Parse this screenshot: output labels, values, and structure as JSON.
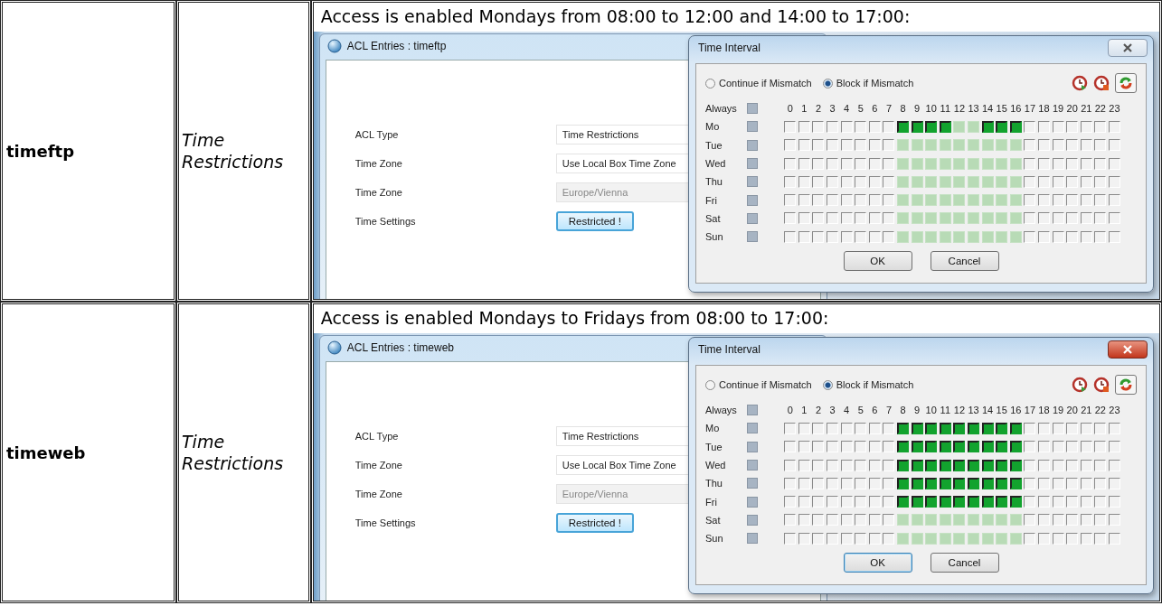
{
  "table": {
    "rows": [
      {
        "name": "timeftp",
        "type": "Time Restrictions",
        "caption": "Access is enabled Mondays from 08:00 to 12:00 and 14:00 to 17:00:",
        "window": {
          "title": "ACL Entries : timeftp",
          "fields": [
            {
              "label": "ACL Type",
              "value": "Time Restrictions",
              "kind": "select"
            },
            {
              "label": "Time Zone",
              "value": "Use Local Box Time Zone",
              "kind": "select"
            },
            {
              "label": "Time Zone",
              "value": "Europe/Vienna",
              "kind": "disabled"
            },
            {
              "label": "Time Settings",
              "value": "Restricted !",
              "kind": "button"
            }
          ]
        },
        "dialog": {
          "title": "Time Interval",
          "close_highlighted": false,
          "modes": [
            {
              "label": "Continue if Mismatch",
              "selected": false
            },
            {
              "label": "Block if Mismatch",
              "selected": true
            }
          ],
          "always_label": "Always",
          "hours": [
            "0",
            "1",
            "2",
            "3",
            "4",
            "5",
            "6",
            "7",
            "8",
            "9",
            "10",
            "11",
            "12",
            "13",
            "14",
            "15",
            "16",
            "17",
            "18",
            "19",
            "20",
            "21",
            "22",
            "23"
          ],
          "days": [
            {
              "label": "Mo",
              "on_hours": [
                false,
                false,
                false,
                false,
                false,
                false,
                false,
                false,
                true,
                true,
                true,
                true,
                false,
                false,
                true,
                true,
                true,
                false,
                false,
                false,
                false,
                false,
                false,
                false
              ],
              "shaded_hours": [
                false,
                false,
                false,
                false,
                false,
                false,
                false,
                false,
                true,
                true,
                true,
                true,
                true,
                true,
                true,
                true,
                true,
                false,
                false,
                false,
                false,
                false,
                false,
                false
              ]
            },
            {
              "label": "Tue",
              "on_hours": [
                false,
                false,
                false,
                false,
                false,
                false,
                false,
                false,
                false,
                false,
                false,
                false,
                false,
                false,
                false,
                false,
                false,
                false,
                false,
                false,
                false,
                false,
                false,
                false
              ],
              "shaded_hours": [
                false,
                false,
                false,
                false,
                false,
                false,
                false,
                false,
                true,
                true,
                true,
                true,
                true,
                true,
                true,
                true,
                true,
                false,
                false,
                false,
                false,
                false,
                false,
                false
              ]
            },
            {
              "label": "Wed",
              "on_hours": [
                false,
                false,
                false,
                false,
                false,
                false,
                false,
                false,
                false,
                false,
                false,
                false,
                false,
                false,
                false,
                false,
                false,
                false,
                false,
                false,
                false,
                false,
                false,
                false
              ],
              "shaded_hours": [
                false,
                false,
                false,
                false,
                false,
                false,
                false,
                false,
                true,
                true,
                true,
                true,
                true,
                true,
                true,
                true,
                true,
                false,
                false,
                false,
                false,
                false,
                false,
                false
              ]
            },
            {
              "label": "Thu",
              "on_hours": [
                false,
                false,
                false,
                false,
                false,
                false,
                false,
                false,
                false,
                false,
                false,
                false,
                false,
                false,
                false,
                false,
                false,
                false,
                false,
                false,
                false,
                false,
                false,
                false
              ],
              "shaded_hours": [
                false,
                false,
                false,
                false,
                false,
                false,
                false,
                false,
                true,
                true,
                true,
                true,
                true,
                true,
                true,
                true,
                true,
                false,
                false,
                false,
                false,
                false,
                false,
                false
              ]
            },
            {
              "label": "Fri",
              "on_hours": [
                false,
                false,
                false,
                false,
                false,
                false,
                false,
                false,
                false,
                false,
                false,
                false,
                false,
                false,
                false,
                false,
                false,
                false,
                false,
                false,
                false,
                false,
                false,
                false
              ],
              "shaded_hours": [
                false,
                false,
                false,
                false,
                false,
                false,
                false,
                false,
                true,
                true,
                true,
                true,
                true,
                true,
                true,
                true,
                true,
                false,
                false,
                false,
                false,
                false,
                false,
                false
              ]
            },
            {
              "label": "Sat",
              "on_hours": [
                false,
                false,
                false,
                false,
                false,
                false,
                false,
                false,
                false,
                false,
                false,
                false,
                false,
                false,
                false,
                false,
                false,
                false,
                false,
                false,
                false,
                false,
                false,
                false
              ],
              "shaded_hours": [
                false,
                false,
                false,
                false,
                false,
                false,
                false,
                false,
                true,
                true,
                true,
                true,
                true,
                true,
                true,
                true,
                true,
                false,
                false,
                false,
                false,
                false,
                false,
                false
              ]
            },
            {
              "label": "Sun",
              "on_hours": [
                false,
                false,
                false,
                false,
                false,
                false,
                false,
                false,
                false,
                false,
                false,
                false,
                false,
                false,
                false,
                false,
                false,
                false,
                false,
                false,
                false,
                false,
                false,
                false
              ],
              "shaded_hours": [
                false,
                false,
                false,
                false,
                false,
                false,
                false,
                false,
                true,
                true,
                true,
                true,
                true,
                true,
                true,
                true,
                true,
                false,
                false,
                false,
                false,
                false,
                false,
                false
              ]
            }
          ],
          "buttons": [
            {
              "label": "OK",
              "default": false
            },
            {
              "label": "Cancel",
              "default": false
            }
          ]
        }
      },
      {
        "name": "timeweb",
        "type": "Time Restrictions",
        "caption": "Access is enabled Mondays to Fridays from 08:00 to 17:00:",
        "window": {
          "title": "ACL Entries : timeweb",
          "fields": [
            {
              "label": "ACL Type",
              "value": "Time Restrictions",
              "kind": "select"
            },
            {
              "label": "Time Zone",
              "value": "Use Local Box Time Zone",
              "kind": "select"
            },
            {
              "label": "Time Zone",
              "value": "Europe/Vienna",
              "kind": "disabled"
            },
            {
              "label": "Time Settings",
              "value": "Restricted !",
              "kind": "button"
            }
          ]
        },
        "dialog": {
          "title": "Time Interval",
          "close_highlighted": true,
          "modes": [
            {
              "label": "Continue if Mismatch",
              "selected": false
            },
            {
              "label": "Block if Mismatch",
              "selected": true
            }
          ],
          "always_label": "Always",
          "hours": [
            "0",
            "1",
            "2",
            "3",
            "4",
            "5",
            "6",
            "7",
            "8",
            "9",
            "10",
            "11",
            "12",
            "13",
            "14",
            "15",
            "16",
            "17",
            "18",
            "19",
            "20",
            "21",
            "22",
            "23"
          ],
          "days": [
            {
              "label": "Mo",
              "on_hours": [
                false,
                false,
                false,
                false,
                false,
                false,
                false,
                false,
                true,
                true,
                true,
                true,
                true,
                true,
                true,
                true,
                true,
                false,
                false,
                false,
                false,
                false,
                false,
                false
              ],
              "shaded_hours": [
                false,
                false,
                false,
                false,
                false,
                false,
                false,
                false,
                true,
                true,
                true,
                true,
                true,
                true,
                true,
                true,
                true,
                false,
                false,
                false,
                false,
                false,
                false,
                false
              ]
            },
            {
              "label": "Tue",
              "on_hours": [
                false,
                false,
                false,
                false,
                false,
                false,
                false,
                false,
                true,
                true,
                true,
                true,
                true,
                true,
                true,
                true,
                true,
                false,
                false,
                false,
                false,
                false,
                false,
                false
              ],
              "shaded_hours": [
                false,
                false,
                false,
                false,
                false,
                false,
                false,
                false,
                true,
                true,
                true,
                true,
                true,
                true,
                true,
                true,
                true,
                false,
                false,
                false,
                false,
                false,
                false,
                false
              ]
            },
            {
              "label": "Wed",
              "on_hours": [
                false,
                false,
                false,
                false,
                false,
                false,
                false,
                false,
                true,
                true,
                true,
                true,
                true,
                true,
                true,
                true,
                true,
                false,
                false,
                false,
                false,
                false,
                false,
                false
              ],
              "shaded_hours": [
                false,
                false,
                false,
                false,
                false,
                false,
                false,
                false,
                true,
                true,
                true,
                true,
                true,
                true,
                true,
                true,
                true,
                false,
                false,
                false,
                false,
                false,
                false,
                false
              ]
            },
            {
              "label": "Thu",
              "on_hours": [
                false,
                false,
                false,
                false,
                false,
                false,
                false,
                false,
                true,
                true,
                true,
                true,
                true,
                true,
                true,
                true,
                true,
                false,
                false,
                false,
                false,
                false,
                false,
                false
              ],
              "shaded_hours": [
                false,
                false,
                false,
                false,
                false,
                false,
                false,
                false,
                true,
                true,
                true,
                true,
                true,
                true,
                true,
                true,
                true,
                false,
                false,
                false,
                false,
                false,
                false,
                false
              ]
            },
            {
              "label": "Fri",
              "on_hours": [
                false,
                false,
                false,
                false,
                false,
                false,
                false,
                false,
                true,
                true,
                true,
                true,
                true,
                true,
                true,
                true,
                true,
                false,
                false,
                false,
                false,
                false,
                false,
                false
              ],
              "shaded_hours": [
                false,
                false,
                false,
                false,
                false,
                false,
                false,
                false,
                true,
                true,
                true,
                true,
                true,
                true,
                true,
                true,
                true,
                false,
                false,
                false,
                false,
                false,
                false,
                false
              ]
            },
            {
              "label": "Sat",
              "on_hours": [
                false,
                false,
                false,
                false,
                false,
                false,
                false,
                false,
                false,
                false,
                false,
                false,
                false,
                false,
                false,
                false,
                false,
                false,
                false,
                false,
                false,
                false,
                false,
                false
              ],
              "shaded_hours": [
                false,
                false,
                false,
                false,
                false,
                false,
                false,
                false,
                true,
                true,
                true,
                true,
                true,
                true,
                true,
                true,
                true,
                false,
                false,
                false,
                false,
                false,
                false,
                false
              ]
            },
            {
              "label": "Sun",
              "on_hours": [
                false,
                false,
                false,
                false,
                false,
                false,
                false,
                false,
                false,
                false,
                false,
                false,
                false,
                false,
                false,
                false,
                false,
                false,
                false,
                false,
                false,
                false,
                false,
                false
              ],
              "shaded_hours": [
                false,
                false,
                false,
                false,
                false,
                false,
                false,
                false,
                true,
                true,
                true,
                true,
                true,
                true,
                true,
                true,
                true,
                false,
                false,
                false,
                false,
                false,
                false,
                false
              ]
            }
          ],
          "buttons": [
            {
              "label": "OK",
              "default": true
            },
            {
              "label": "Cancel",
              "default": false
            }
          ]
        }
      }
    ]
  }
}
